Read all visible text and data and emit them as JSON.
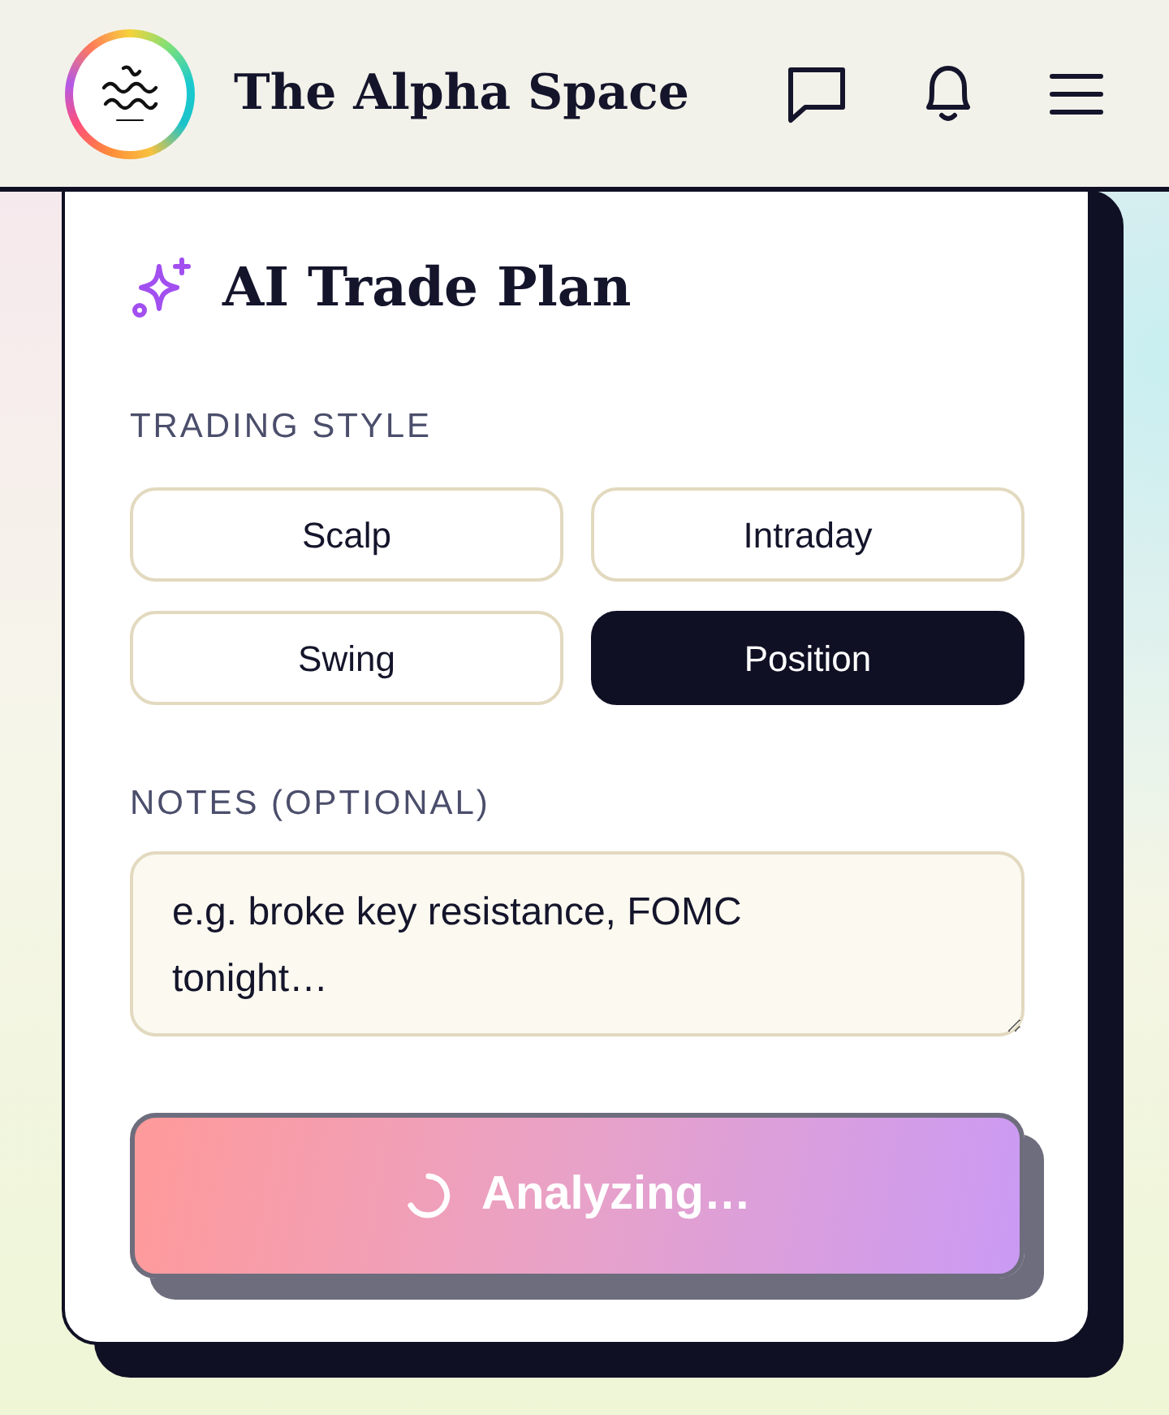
{
  "header": {
    "title": "The Alpha Space"
  },
  "card": {
    "title": "AI Trade Plan",
    "trading_style": {
      "label": "TRADING STYLE",
      "options": [
        {
          "label": "Scalp",
          "selected": false
        },
        {
          "label": "Intraday",
          "selected": false
        },
        {
          "label": "Swing",
          "selected": false
        },
        {
          "label": "Position",
          "selected": true
        }
      ]
    },
    "notes": {
      "label": "NOTES (OPTIONAL)",
      "placeholder": "e.g. broke key resistance, FOMC tonight…"
    },
    "submit": {
      "label": "Analyzing…",
      "loading": true
    }
  }
}
